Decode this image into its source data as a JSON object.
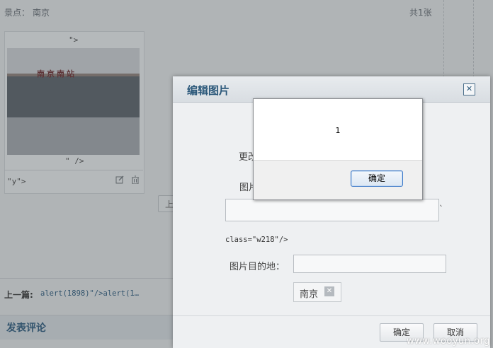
{
  "page": {
    "scenic_label": "景点：",
    "scenic_value": "南京",
    "count_text": "共1张",
    "photo_top_artifact": "\">",
    "photo_sign_text": "南京南站",
    "photo_bottom_artifact": "\" />",
    "photo_caption_artifact": "\"y\">",
    "edit_icon": "edit-icon",
    "delete_icon": "trash-icon",
    "upload_button_fragment": "上",
    "prev_label": "上一篇:",
    "prev_value": "alert(1898)\"/>alert(1…",
    "comment_heading": "发表评论"
  },
  "dialog": {
    "title": "编辑图片",
    "close_glyph": "✕",
    "change_label_fragment": "更改",
    "image_label_fragment": "图片",
    "textarea_trailing_mark": "ˎ",
    "class_artifact": "class=\"w218\"/>",
    "destination_label": "图片目的地：",
    "destination_input_value": "",
    "destination_tag": "南京",
    "tag_remove_glyph": "✕",
    "confirm_label": "确定",
    "cancel_label": "取消"
  },
  "alert": {
    "message": "1",
    "ok_label": "确定"
  },
  "watermark": "www.wooyun.org"
}
